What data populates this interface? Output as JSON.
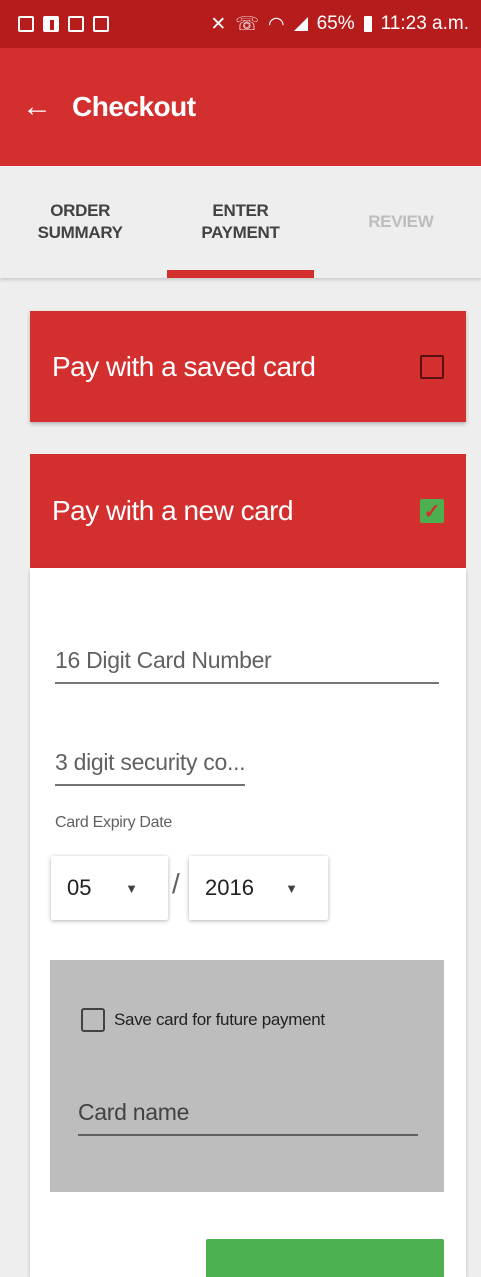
{
  "status_bar": {
    "battery": "65%",
    "time": "11:23 a.m."
  },
  "app_bar": {
    "title": "Checkout"
  },
  "tabs": [
    {
      "label": "ORDER\nSUMMARY",
      "state": "normal"
    },
    {
      "label": "ENTER\nPAYMENT",
      "state": "active"
    },
    {
      "label": "REVIEW",
      "state": "disabled"
    }
  ],
  "saved_card": {
    "label": "Pay with a saved card",
    "checked": false
  },
  "new_card": {
    "label": "Pay with a new card",
    "checked": true
  },
  "form": {
    "card_number_placeholder": "16 Digit Card Number",
    "security_placeholder": "3 digit security co...",
    "expiry_label": "Card Expiry Date",
    "expiry_month": "05",
    "expiry_separator": "/",
    "expiry_year": "2016",
    "save_label": "Save card for future payment",
    "save_checked": false,
    "card_name_placeholder": "Card name"
  },
  "colors": {
    "primary": "#d32f2f",
    "status_bar": "#b71c1c",
    "accent_green": "#4caf50"
  }
}
